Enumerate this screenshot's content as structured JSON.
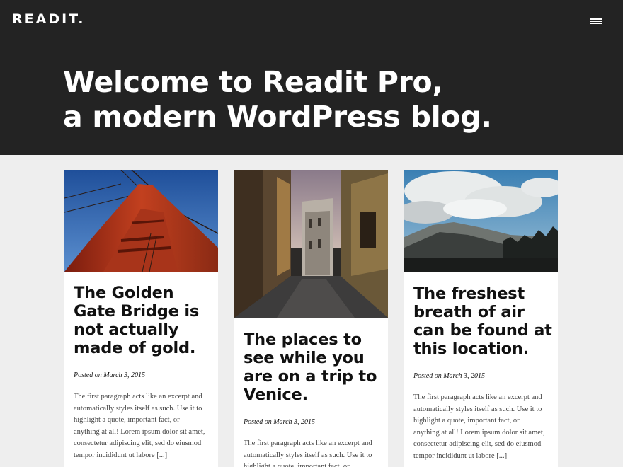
{
  "site": {
    "logo": "READIT."
  },
  "header": {
    "menu_icon": "hamburger-menu-icon",
    "title_lines": [
      "Welcome to Readit Pro,",
      "a modern WordPress blog."
    ]
  },
  "colors": {
    "header_bg": "#232323",
    "page_bg": "#eeeeee",
    "card_bg": "#ffffff"
  },
  "posts": [
    {
      "image": "golden-gate-bridge-photo",
      "title_lines": [
        "The Golden",
        "Gate Bridge is",
        "not actually",
        "made of gold."
      ],
      "meta_prefix": "Posted on",
      "date": "March 3, 2015",
      "excerpt_lines": [
        "The first paragraph acts like an excerpt and",
        "automatically styles itself as such. Use it to",
        "highlight a quote, important fact, or",
        "anything at all! Lorem ipsum dolor sit amet,",
        "consectetur adipiscing elit, sed do eiusmod",
        "tempor incididunt ut labore"
      ],
      "more": "[...]"
    },
    {
      "image": "venice-street-photo",
      "title_lines": [
        "The places to",
        "see while you",
        "are on a trip to",
        "Venice."
      ],
      "meta_prefix": "Posted on",
      "date": "March 3, 2015",
      "excerpt_lines": [
        "The first paragraph acts like an excerpt and",
        "automatically styles itself as such. Use it to",
        "highlight a quote, important fact, or"
      ]
    },
    {
      "image": "mountain-clouds-photo",
      "title_lines": [
        "The freshest",
        "breath of air",
        "can be found at",
        "this location."
      ],
      "meta_prefix": "Posted on",
      "date": "March 3, 2015",
      "excerpt_lines": [
        "The first paragraph acts like an excerpt and",
        "automatically styles itself as such. Use it to",
        "highlight a quote, important fact, or",
        "anything at all! Lorem ipsum dolor sit amet,",
        "consectetur adipiscing elit, sed do eiusmod",
        "tempor incididunt ut labore"
      ],
      "more": "[...]"
    }
  ]
}
